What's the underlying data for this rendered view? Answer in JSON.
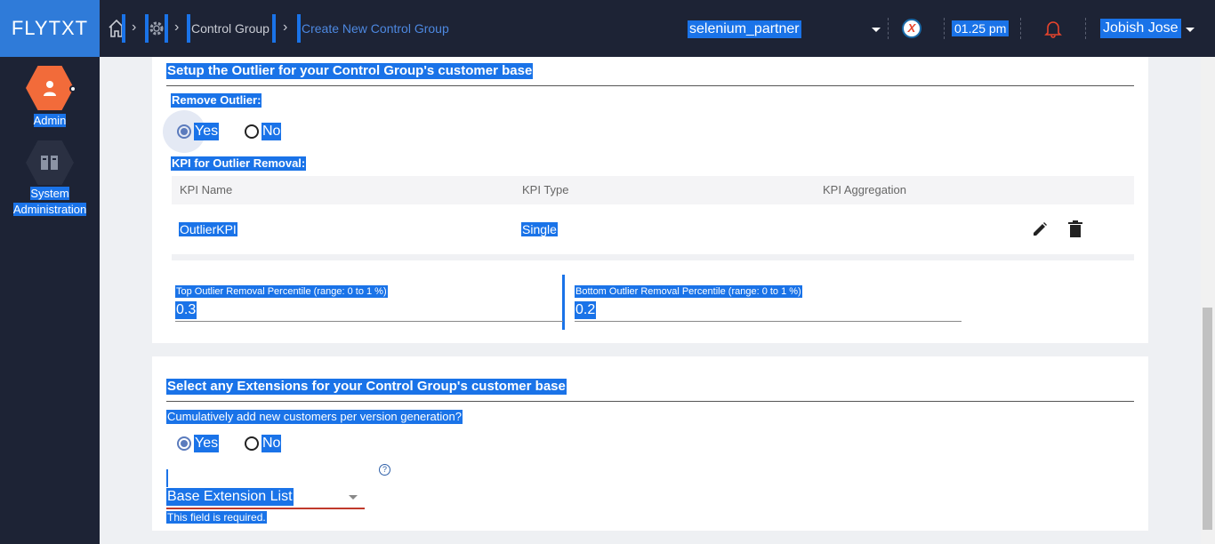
{
  "app": {
    "logo": "FLYTXT"
  },
  "breadcrumb": {
    "items": [
      "Control Group",
      "Create New Control Group"
    ]
  },
  "header": {
    "partner": "selenium_partner",
    "time": "01.25 pm",
    "user": "Jobish Jose",
    "badge_letter": "X"
  },
  "sidebar": {
    "items": [
      {
        "label": "Admin",
        "color": "#f26b3a"
      },
      {
        "label_line1": "System",
        "label_line2": "Administration",
        "color": "#2a3042"
      }
    ]
  },
  "outlier": {
    "title": "Setup the Outlier for your Control Group's customer base",
    "remove_label": "Remove Outlier:",
    "yes": "Yes",
    "no": "No",
    "selected": "Yes",
    "kpi_label": "KPI for Outlier Removal:",
    "table": {
      "headers": [
        "KPI Name",
        "KPI Type",
        "KPI Aggregation"
      ],
      "rows": [
        {
          "name": "OutlierKPI",
          "type": "Single",
          "aggregation": ""
        }
      ]
    },
    "top_label": "Top Outlier Removal Percentile (range: 0 to 1 %)",
    "top_value": "0.3",
    "bottom_label": "Bottom Outlier Removal Percentile (range: 0 to 1 %)",
    "bottom_value": "0.2"
  },
  "extensions": {
    "title": "Select any Extensions for your Control Group's customer base",
    "question": "Cumulatively add new customers per version generation?",
    "yes": "Yes",
    "no": "No",
    "selected": "Yes",
    "select_placeholder": "Base Extension List",
    "help": "?",
    "error": "This field is required."
  },
  "colors": {
    "selection": "#1a73e8",
    "topbar": "#1d2335",
    "logo_bg": "#2f7bd9",
    "error_underline": "#c0392b"
  }
}
